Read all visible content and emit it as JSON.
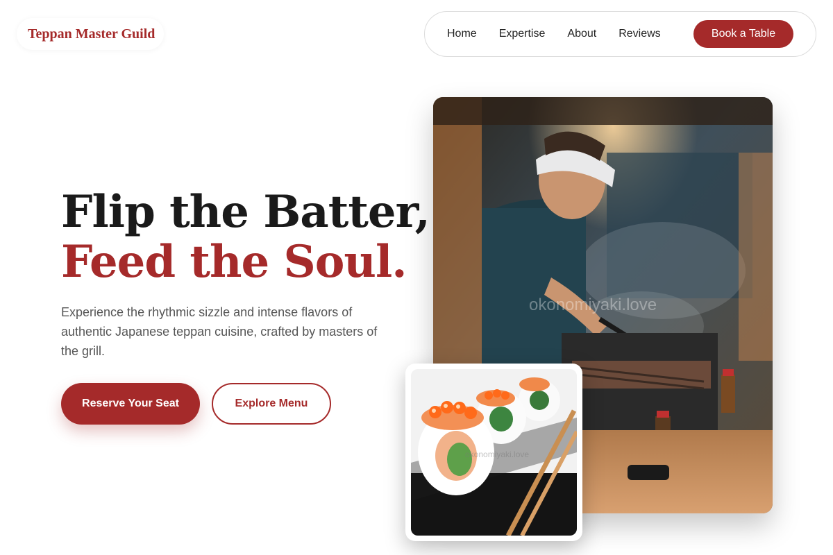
{
  "brand": {
    "name": "Teppan Master Guild"
  },
  "nav": {
    "items": [
      "Home",
      "Expertise",
      "About",
      "Reviews"
    ],
    "cta": "Book a Table"
  },
  "hero": {
    "title_line1": "Flip the Batter,",
    "title_line2": "Feed the Soul.",
    "subtitle": "Experience the rhythmic sizzle and intense flavors of authentic Japanese teppan cuisine, crafted by masters of the grill.",
    "primary_button": "Reserve Your Seat",
    "secondary_button": "Explore Menu"
  },
  "images": {
    "main_watermark": "okonomiyaki.love",
    "inset_watermark": "okonomiyaki.love"
  },
  "colors": {
    "accent": "#a52a2a",
    "text_dark": "#1a1a1a",
    "text_muted": "#555555"
  },
  "icons": [
    "chef-grilling-photo",
    "sushi-roll-photo"
  ]
}
